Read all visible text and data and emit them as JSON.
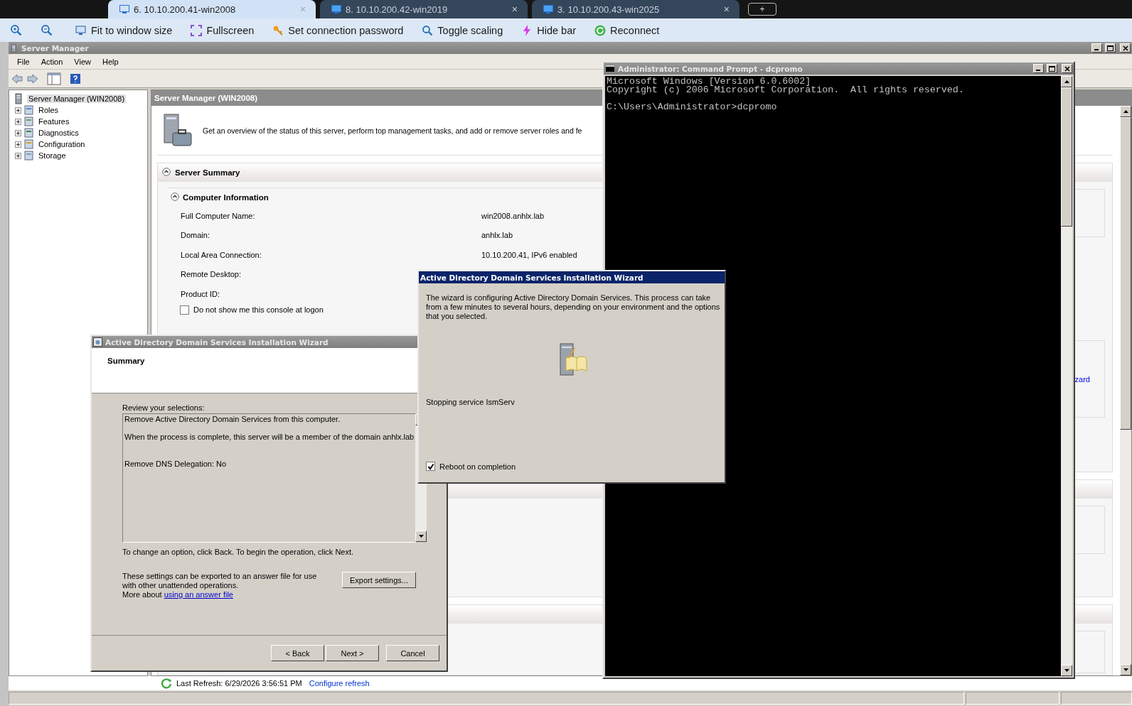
{
  "browser_tabs": [
    {
      "label": "6. 10.10.200.41-win2008",
      "close": "×",
      "selected": true
    },
    {
      "label": "8. 10.10.200.42-win2019",
      "close": "×",
      "selected": false
    },
    {
      "label": "3. 10.10.200.43-win2025",
      "close": "×",
      "selected": false
    }
  ],
  "new_tab": "+",
  "toolbar": [
    "Fit to window size",
    "Fullscreen",
    "Set connection password",
    "Toggle scaling",
    "Hide bar",
    "Reconnect"
  ],
  "server_manager": {
    "title": "Server Manager",
    "menu": [
      "File",
      "Action",
      "View",
      "Help"
    ],
    "tree": {
      "label": "Server Manager (WIN2008)",
      "selected": true,
      "children": [
        {
          "label": "Roles",
          "expanded": false,
          "selected": false
        },
        {
          "label": "Features",
          "expanded": false,
          "selected": false
        },
        {
          "label": "Diagnostics",
          "expanded": false,
          "selected": false
        },
        {
          "label": "Configuration",
          "expanded": false,
          "selected": false
        },
        {
          "label": "Storage",
          "expanded": false,
          "selected": false
        }
      ]
    },
    "pane_title": "Server Manager (WIN2008)",
    "intro": "Get an overview of the status of this server, perform top management tasks, and add or remove server roles and fe",
    "summary_section": {
      "title": "Server Summary",
      "expanded": true,
      "computer_info": {
        "title": "Computer Information",
        "expanded": true,
        "rows": [
          {
            "label": "Full Computer Name:",
            "value": "win2008.anhlx.lab"
          },
          {
            "label": "Domain:",
            "value": "anhlx.lab"
          },
          {
            "label": "Local Area Connection:",
            "value": "10.10.200.41, IPv6 enabled"
          },
          {
            "label": "Remote Desktop:"
          },
          {
            "label": "Product ID:"
          }
        ]
      },
      "logon_option": {
        "label": "Do not show me this console at logon",
        "checked": false
      },
      "task_link": "zard"
    },
    "status": {
      "last_refresh": "Last Refresh: 6/29/2026 3:56:51 PM",
      "configure_link": "Configure refresh"
    }
  },
  "command_prompt": {
    "title": "Administrator: Command Prompt - dcpromo",
    "output": [
      "Microsoft Windows [Version 6.0.6002]",
      "Copyright (c) 2006 Microsoft Corporation.  All rights reserved."
    ],
    "prompt": "C:\\Users\\Administrator>dcpromo"
  },
  "progress_wizard": {
    "title": "Active Directory Domain Services Installation Wizard",
    "message": "The wizard is configuring Active Directory Domain Services. This process can take from a few minutes to several hours, depending on your environment and the options that you selected.",
    "status": "Stopping service IsmServ",
    "reboot": {
      "label": "Reboot on completion",
      "checked": true
    }
  },
  "summary_wizard": {
    "title": "Active Directory Domain Services Installation Wizard",
    "heading": "Summary",
    "review_label": "Review your selections:",
    "selections": [
      "Remove Active Directory Domain Services from this computer.",
      "When the process is complete, this server will be a member of the domain anhlx.lab",
      "Remove DNS Delegation: No"
    ],
    "change_hint": "To change an option, click Back. To begin the operation, click Next.",
    "export_text": "These settings can be exported to an answer file for use with other unattended operations.",
    "more_about": "More about",
    "more_link": "using an answer file",
    "export_button": "Export settings...",
    "buttons": [
      "< Back",
      "Next >",
      "Cancel"
    ]
  }
}
